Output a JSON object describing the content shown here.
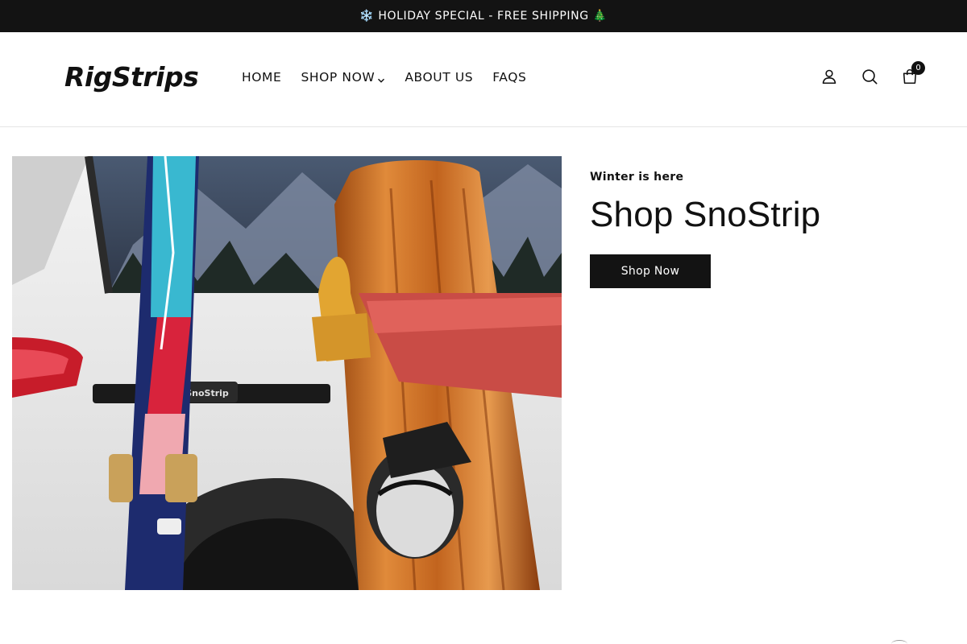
{
  "announcement": {
    "text": "❄️ HOLIDAY SPECIAL - FREE SHIPPING 🎄"
  },
  "header": {
    "logo": "RigStrips",
    "nav": [
      {
        "label": "HOME"
      },
      {
        "label": "SHOP NOW",
        "has_dropdown": true
      },
      {
        "label": "ABOUT US"
      },
      {
        "label": "FAQS"
      }
    ],
    "icons": [
      "account-icon",
      "search-icon",
      "cart-icon"
    ],
    "cart_count": "0"
  },
  "hero": {
    "image_label": "SnoStrip",
    "eyebrow": "Winter is here",
    "headline": "Shop SnoStrip",
    "cta_label": "Shop Now"
  },
  "colors": {
    "bar": "#131313",
    "text": "#111111",
    "button": "#131313"
  }
}
